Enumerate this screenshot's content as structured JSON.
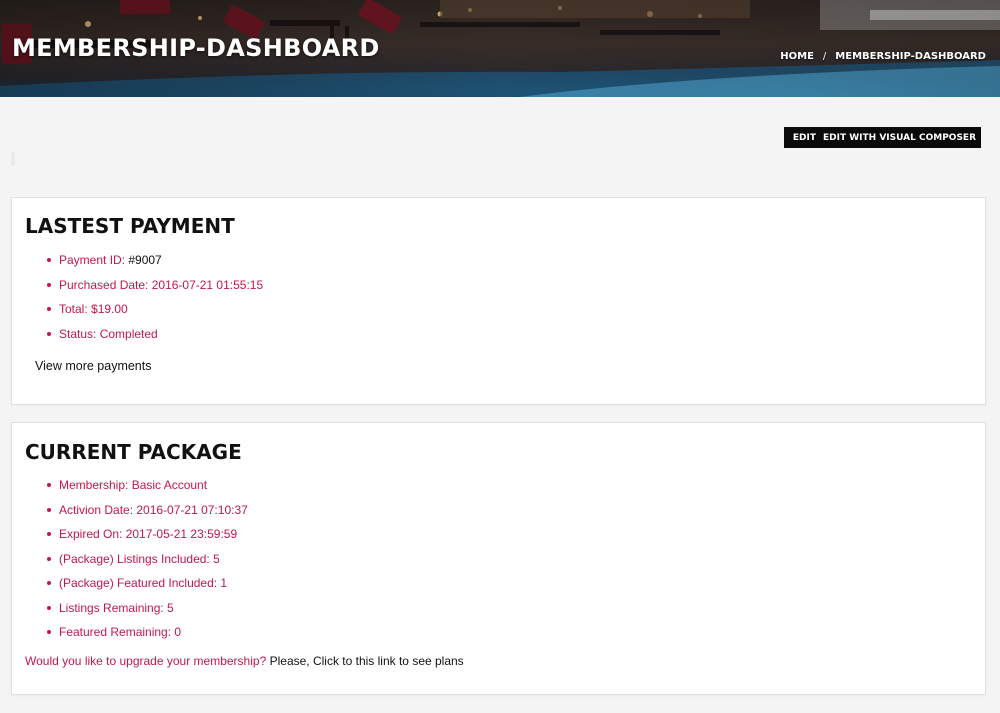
{
  "header": {
    "title": "MEMBERSHIP-DASHBOARD",
    "breadcrumb": {
      "home": "HOME",
      "separator": "/",
      "current": "MEMBERSHIP-DASHBOARD"
    }
  },
  "admin_bar": {
    "edit": "EDIT",
    "edit_visual": "EDIT WITH VISUAL COMPOSER"
  },
  "latest_payment": {
    "title": "LASTEST PAYMENT",
    "items": [
      {
        "label": "Payment ID: ",
        "value": "#9007"
      },
      {
        "label": "Purchased Date: 2016-07-21 01:55:15"
      },
      {
        "label": "Total: $19.00"
      },
      {
        "label": "Status: Completed"
      }
    ],
    "view_more": "View more payments"
  },
  "current_package": {
    "title": "CURRENT PACKAGE",
    "items": [
      "Membership: Basic Account",
      "Activion Date: 2016-07-21 07:10:37",
      "Expired On: 2017-05-21 23:59:59",
      "(Package) Listings Included: 5",
      "(Package) Featured Included: 1",
      "Listings Remaining: 5",
      "Featured Remaining: 0"
    ],
    "upgrade_question": "Would you like to upgrade your membership?",
    "upgrade_link": "Please, Click to this link to see plans"
  },
  "colors": {
    "accent": "#c2184a",
    "text": "#111111",
    "page_bg": "#f4f4f4",
    "admin_bar_bg": "#0b0b0b"
  }
}
